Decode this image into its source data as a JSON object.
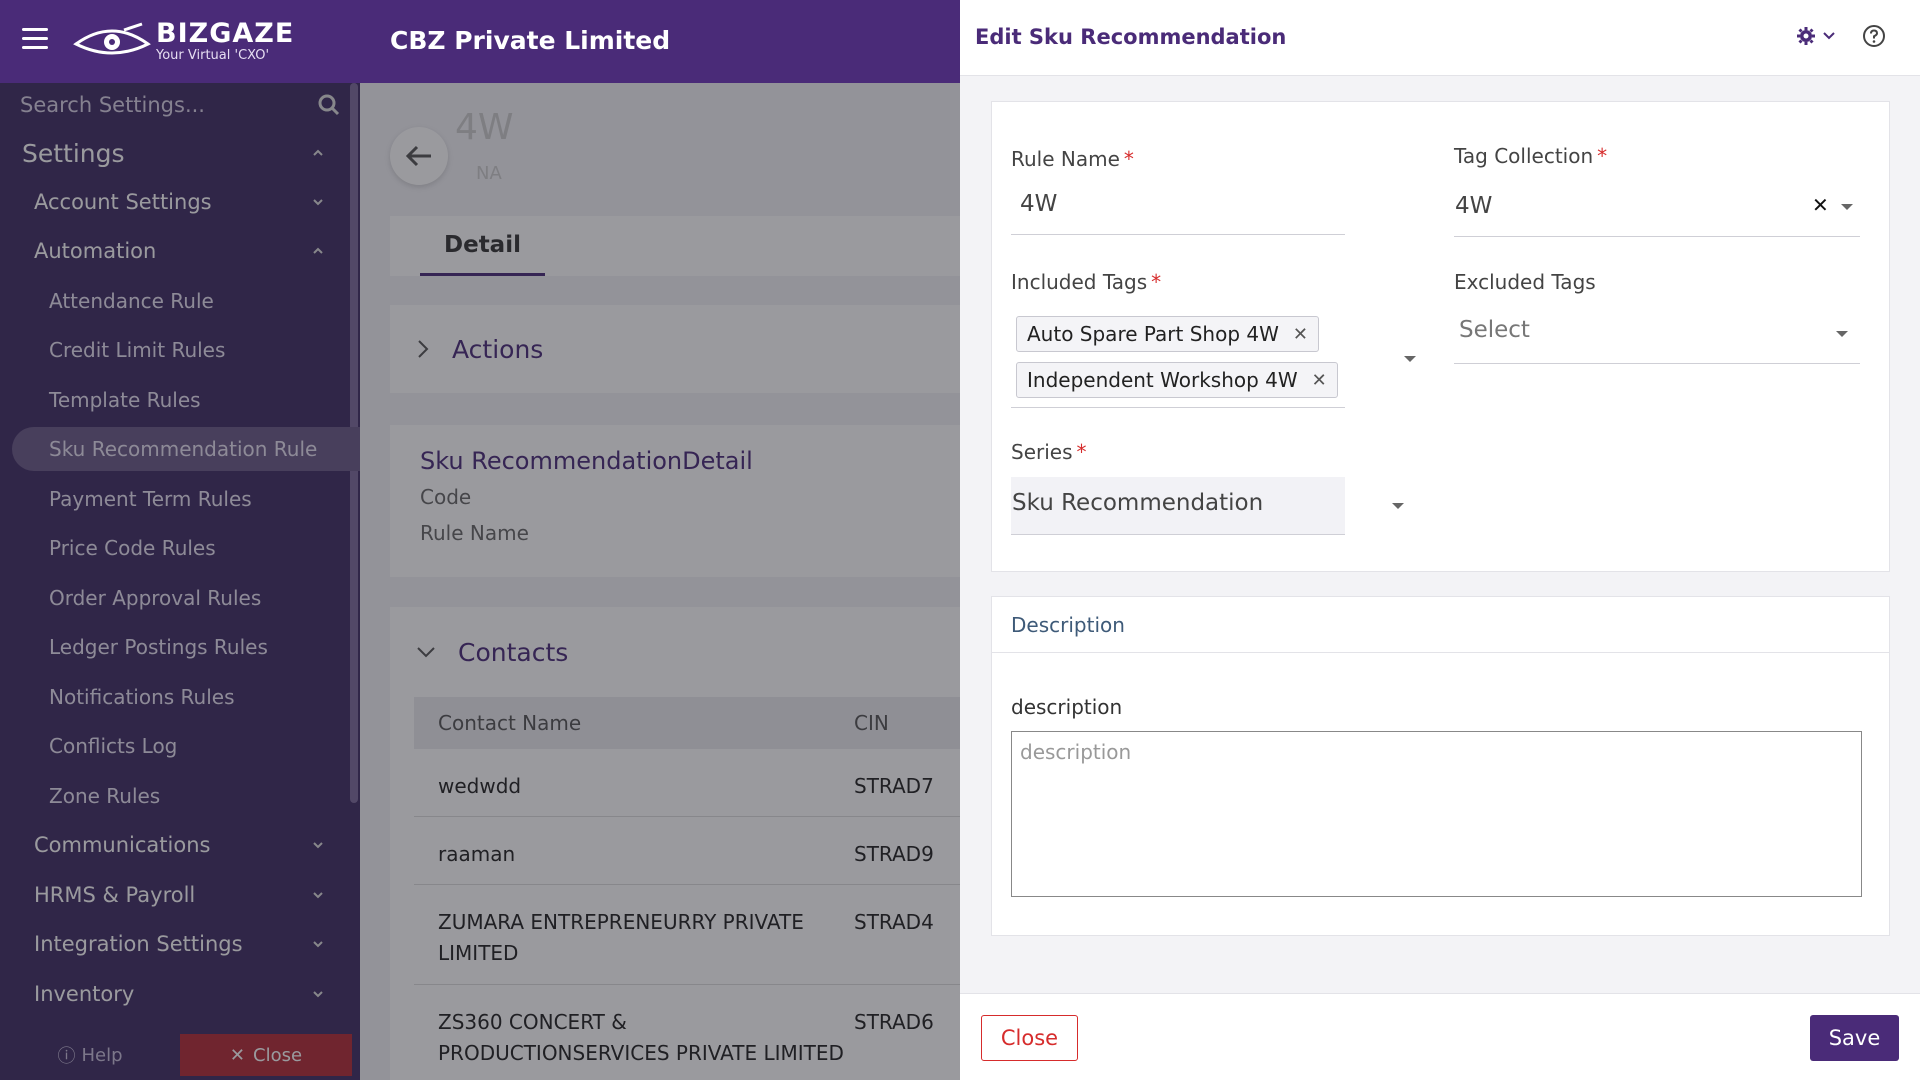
{
  "colors": {
    "brand": "#4a2b78",
    "sidebar": "#3f2c63",
    "danger": "#d62c2c"
  },
  "header": {
    "logo_name": "BIZGAZE",
    "logo_tagline": "Your Virtual 'CXO'",
    "company": "CBZ Private Limited"
  },
  "sidebar": {
    "search_placeholder": "Search Settings...",
    "settings": "Settings",
    "account_settings": "Account Settings",
    "automation": "Automation",
    "automation_items": [
      "Attendance Rule",
      "Credit Limit Rules",
      "Template Rules",
      "Sku Recommendation Rule",
      "Payment Term Rules",
      "Price Code Rules",
      "Order Approval Rules",
      "Ledger Postings Rules",
      "Notifications Rules",
      "Conflicts Log",
      "Zone Rules"
    ],
    "groups_after": [
      "Communications",
      "HRMS & Payroll",
      "Integration Settings",
      "Inventory"
    ],
    "help": "Help",
    "close": "Close"
  },
  "main": {
    "record_title": "4W",
    "record_sub": "NA",
    "tab_detail": "Detail",
    "actions": "Actions",
    "detail_heading": "Sku RecommendationDetail",
    "detail_fields": [
      "Code",
      "Rule Name"
    ],
    "contacts": "Contacts",
    "contacts_columns": [
      "Contact Name",
      "CIN"
    ],
    "contacts_rows": [
      {
        "name": "wedwdd",
        "cin": "STRAD7"
      },
      {
        "name": "raaman",
        "cin": "STRAD9"
      },
      {
        "name": "ZUMARA ENTREPRENEURRY PRIVATE LIMITED",
        "cin": "STRAD4"
      },
      {
        "name": "ZS360 CONCERT & PRODUCTIONSERVICES PRIVATE LIMITED",
        "cin": "STRAD6"
      }
    ]
  },
  "drawer": {
    "title": "Edit Sku Recommendation",
    "rule_name_label": "Rule Name",
    "rule_name_value": "4W",
    "tag_collection_label": "Tag Collection",
    "tag_collection_value": "4W",
    "included_tags_label": "Included Tags",
    "included_tags": [
      "Auto Spare Part Shop 4W",
      "Independent Workshop 4W"
    ],
    "excluded_tags_label": "Excluded Tags",
    "excluded_tags_placeholder": "Select",
    "series_label": "Series",
    "series_value": "Sku Recommendation",
    "required_mark": "*",
    "description_section": "Description",
    "description_label": "description",
    "description_placeholder": "description",
    "close_label": "Close",
    "save_label": "Save"
  }
}
